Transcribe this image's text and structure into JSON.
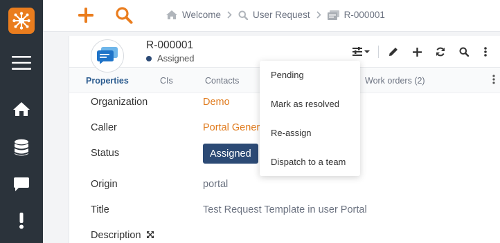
{
  "topbar": {
    "breadcrumbs": [
      {
        "label": "Welcome",
        "icon": "home-icon"
      },
      {
        "label": "User Request",
        "icon": "search-icon"
      },
      {
        "label": "R-000001",
        "icon": "ticket-icon"
      }
    ]
  },
  "ticket": {
    "ref": "R-000001",
    "status": "Assigned"
  },
  "tabs": [
    "Properties",
    "CIs",
    "Contacts",
    "Work orders (2)"
  ],
  "fields": {
    "organization": {
      "label": "Organization",
      "value": "Demo"
    },
    "caller": {
      "label": "Caller",
      "value": "Portal Gener"
    },
    "status": {
      "label": "Status",
      "value": "Assigned"
    },
    "origin": {
      "label": "Origin",
      "value": "portal"
    },
    "title": {
      "label": "Title",
      "value": "Test Request Template in user Portal"
    },
    "description": {
      "label": "Description"
    }
  },
  "menu": {
    "items": [
      "Pending",
      "Mark as resolved",
      "Re-assign",
      "Dispatch to a team"
    ]
  },
  "colors": {
    "sidebar": "#2b333b",
    "accent_orange": "#ea7d1e",
    "status_blue": "#2c4a75",
    "link_orange": "#e07b1e"
  }
}
